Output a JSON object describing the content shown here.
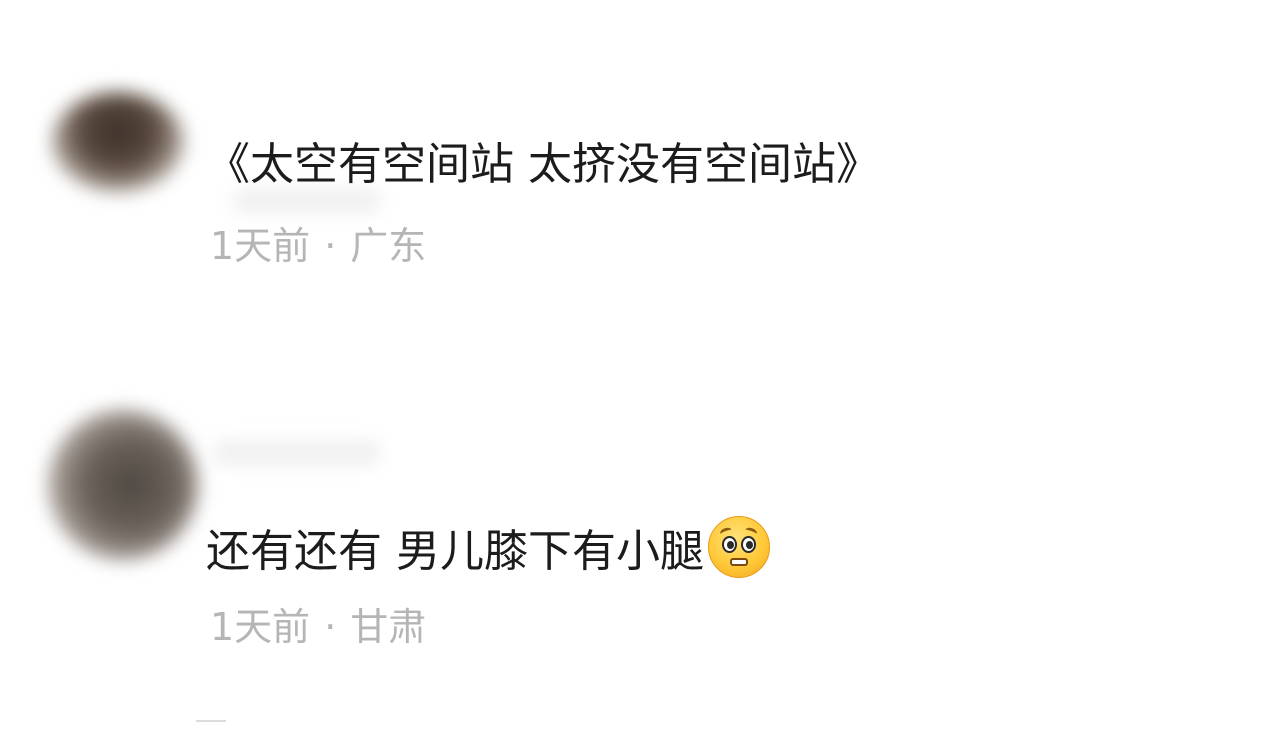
{
  "comments": [
    {
      "text": "《太空有空间站 太挤没有空间站》",
      "time": "1天前",
      "separator": "·",
      "location": "广东",
      "emoji": ""
    },
    {
      "text": "还有还有 男儿膝下有小腿",
      "time": "1天前",
      "separator": "·",
      "location": "甘肃",
      "emoji": "pleading-face-emoji"
    }
  ],
  "colors": {
    "text": "#1c1c1c",
    "meta": "#b5b5b5",
    "background": "#ffffff"
  }
}
